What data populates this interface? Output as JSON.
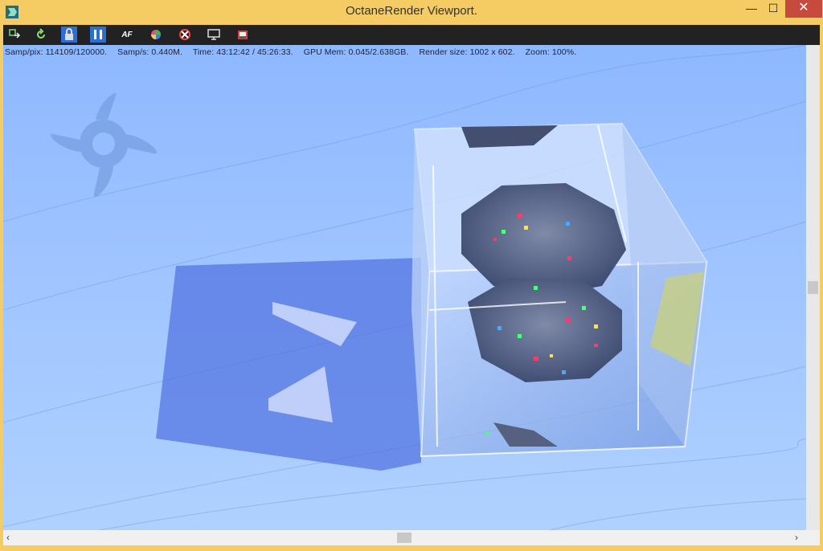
{
  "window": {
    "title": "OctaneRender Viewport."
  },
  "controls": {
    "minimize": "—",
    "maximize": "☐",
    "close": "✕"
  },
  "toolbar": {
    "buttons": [
      {
        "name": "send-scene-icon"
      },
      {
        "name": "restart-render-icon"
      },
      {
        "name": "lock-icon",
        "active": true
      },
      {
        "name": "pause-icon",
        "active": true
      },
      {
        "name": "autofocus-icon",
        "label": "AF"
      },
      {
        "name": "color-picker-icon"
      },
      {
        "name": "clear-region-icon"
      },
      {
        "name": "display-icon"
      },
      {
        "name": "save-image-icon"
      }
    ]
  },
  "status": {
    "samp_pix": "Samp/pix: 114109/120000.",
    "samp_s": "Samp/s: 0.440M.",
    "time": "Time: 43:12:42 / 45:26:33.",
    "gpu_mem": "GPU Mem: 0.045/2.638GB.",
    "render_size": "Render size: 1002 x 602.",
    "zoom": "Zoom: 100%."
  },
  "colors": {
    "titlebar": "#f4cc63",
    "close": "#c74a3f",
    "toolbar": "#222222",
    "active": "#2b6ed6",
    "sky": "#9fc4ff"
  }
}
